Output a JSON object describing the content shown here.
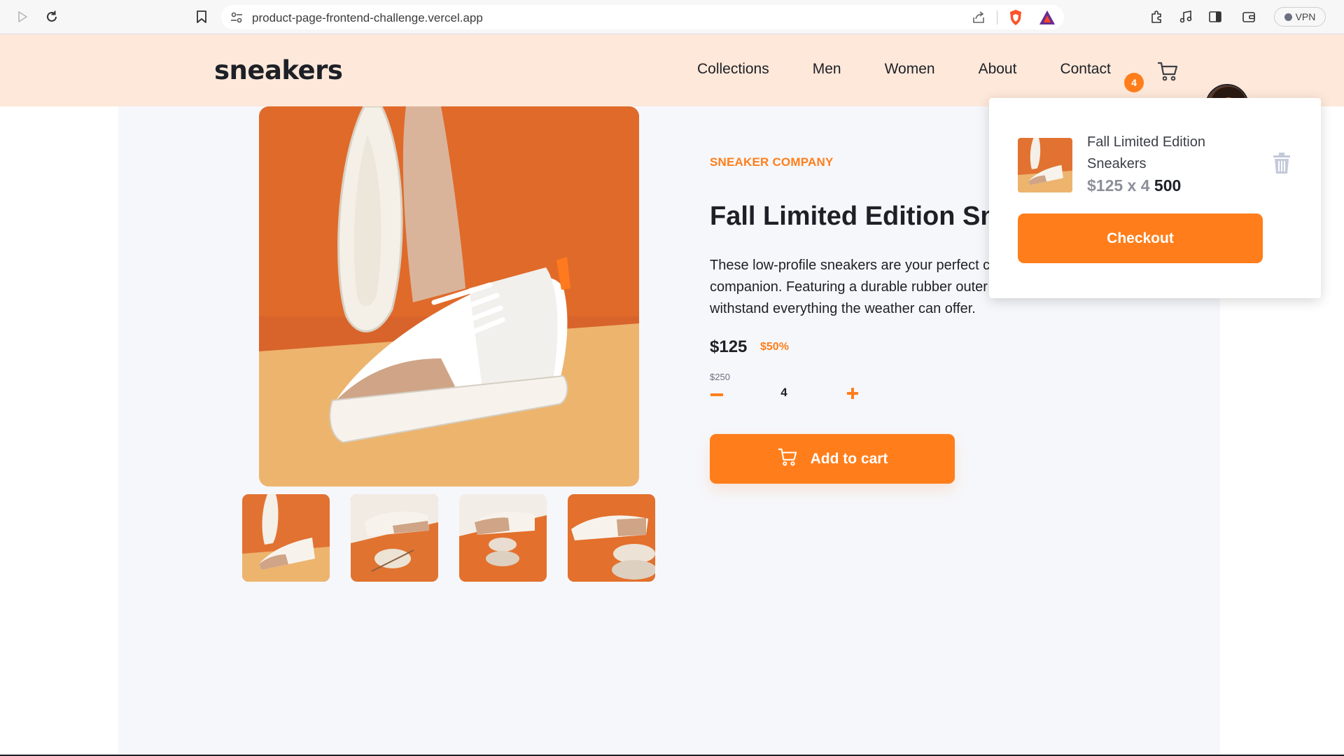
{
  "browser": {
    "url": "product-page-frontend-challenge.vercel.app",
    "vpn_label": "VPN"
  },
  "nav": {
    "logo": "sneakers",
    "links": [
      "Collections",
      "Men",
      "Women",
      "About",
      "Contact"
    ],
    "cart_count": "4"
  },
  "product": {
    "brand": "SNEAKER COMPANY",
    "title": "Fall Limited Edition Sneakers",
    "description_lines": [
      "These low-profile sneakers are your perfect casual wear",
      "companion. Featuring a durable rubber outer sole, they'll",
      "withstand everything the weather can offer."
    ],
    "price": "$125",
    "discount": "$50%",
    "old_price": "$250",
    "quantity": "4",
    "add_to_cart_label": "Add to cart"
  },
  "cart_popup": {
    "item_name": "Fall Limited Edition Sneakers",
    "item_price_line": "$125 x 4",
    "item_total": "500",
    "checkout_label": "Checkout"
  },
  "colors": {
    "accent": "#ff7e1b",
    "nav_background": "#fee8da",
    "page_background": "#f6f7fb",
    "text_dark": "#1d2026"
  },
  "icons": {
    "browser": [
      "play-icon",
      "reload-icon",
      "bookmark-icon",
      "site-settings-icon",
      "share-icon",
      "brave-shield-icon",
      "brave-rewards-icon",
      "extensions-icon",
      "media-icon",
      "sidebar-icon",
      "wallet-icon"
    ],
    "page": [
      "cart-icon",
      "trash-icon",
      "minus-icon",
      "plus-icon"
    ]
  }
}
